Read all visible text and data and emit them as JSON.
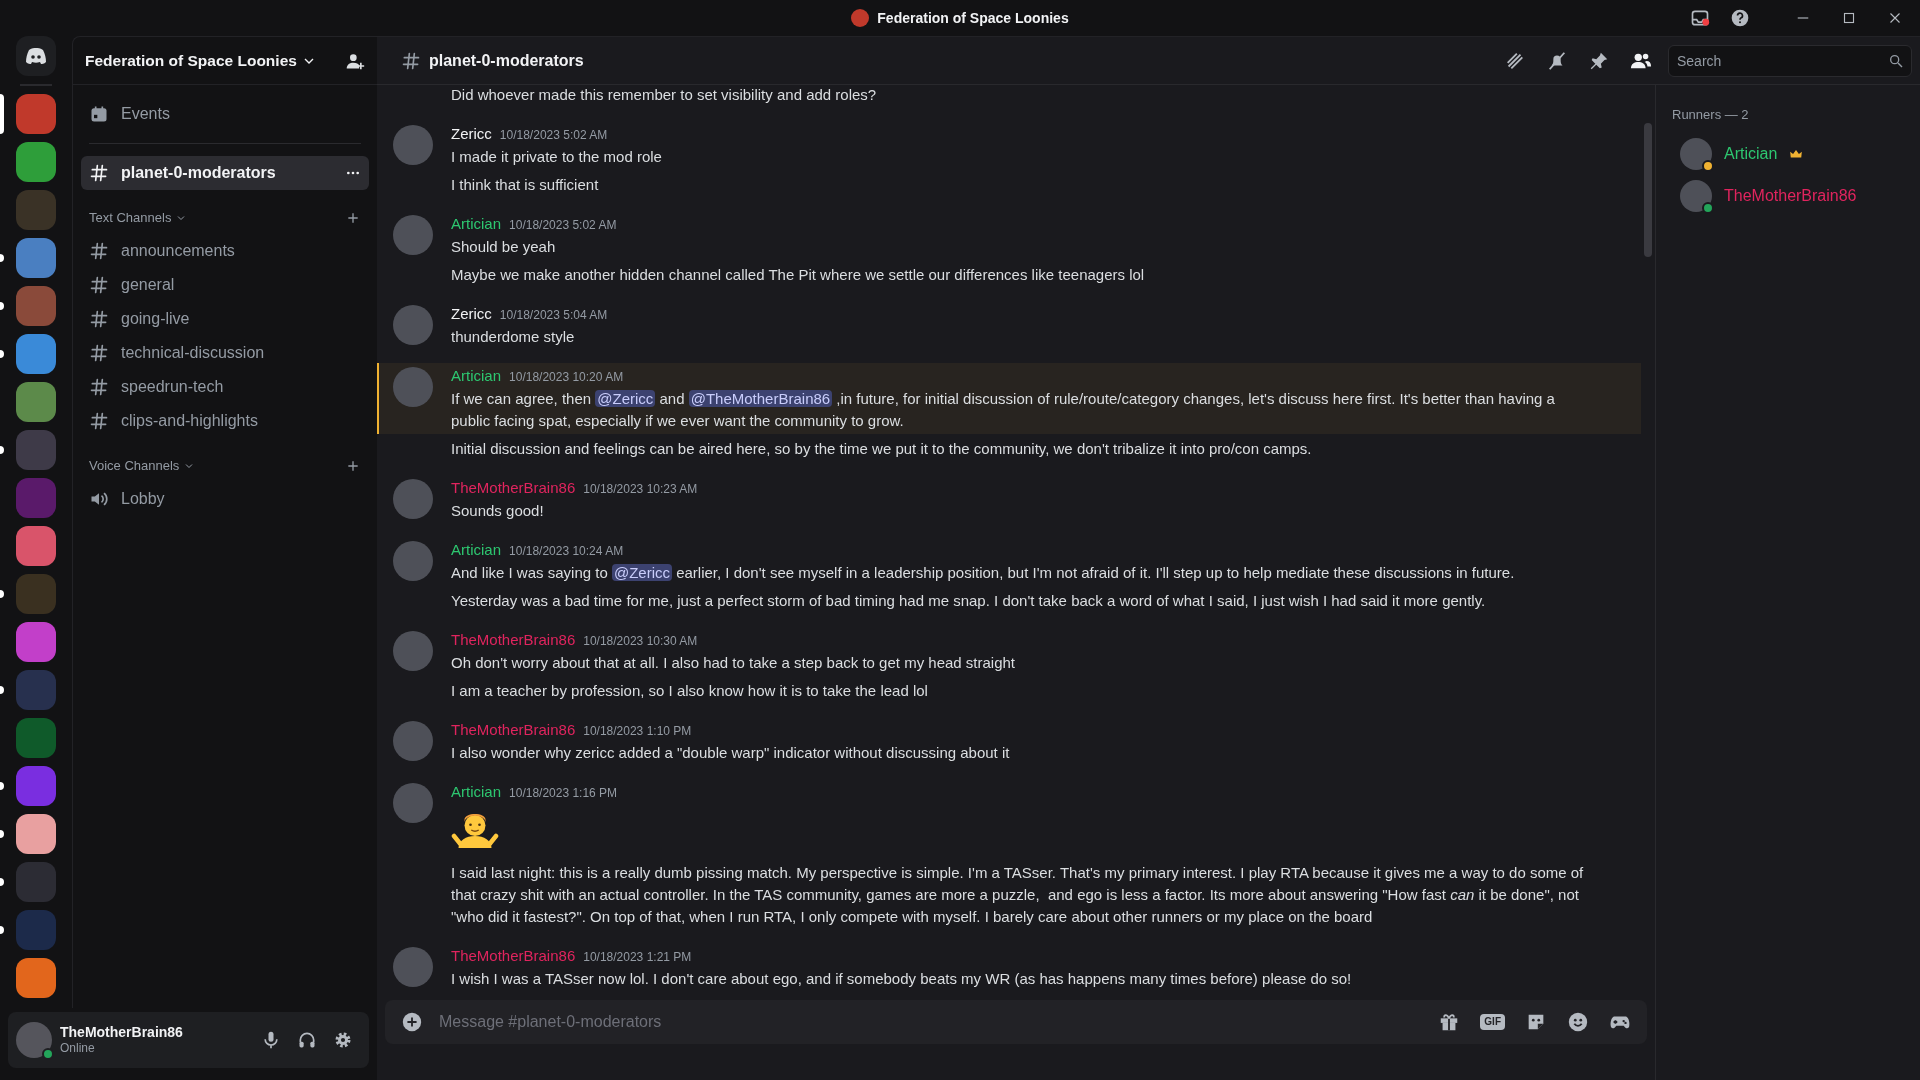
{
  "title_bar": {
    "title": "Federation of Space Loonies"
  },
  "servers": [
    {
      "color": "#c0392b",
      "selected": true
    },
    {
      "color": "#2e9e3a",
      "selected": false,
      "unread": false
    },
    {
      "color": "#3a3226",
      "selected": false,
      "unread": false
    },
    {
      "color": "#4a7fc1",
      "selected": false,
      "unread": true
    },
    {
      "color": "#8a4a3a",
      "selected": false,
      "unread": true
    },
    {
      "color": "#3a8ad8",
      "selected": false,
      "unread": true
    },
    {
      "color": "#5c8a4a",
      "selected": false,
      "unread": false
    },
    {
      "color": "#3e3a48",
      "selected": false,
      "unread": true
    },
    {
      "color": "#5a1a6a",
      "selected": false,
      "unread": false
    },
    {
      "color": "#d9546a",
      "selected": false,
      "unread": false
    },
    {
      "color": "#3a3020",
      "selected": false,
      "unread": true
    },
    {
      "color": "#c23fc9",
      "selected": false,
      "unread": false
    },
    {
      "color": "#27304e",
      "selected": false,
      "unread": true
    },
    {
      "color": "#0f5a2a",
      "selected": false,
      "unread": false
    },
    {
      "color": "#7a2ee0",
      "selected": false,
      "unread": true
    },
    {
      "color": "#e8a0a0",
      "selected": false,
      "unread": true
    },
    {
      "color": "#2c2c34",
      "selected": false,
      "unread": true
    },
    {
      "color": "#1c2a4a",
      "selected": false,
      "unread": true
    },
    {
      "color": "#e2661c",
      "selected": false,
      "unread": false
    }
  ],
  "sidebar": {
    "server_name": "Federation of Space Loonies",
    "events_label": "Events",
    "pinned_channel": {
      "name": "planet-0-moderators",
      "selected": true
    },
    "categories": [
      {
        "name": "Text Channels",
        "channels": [
          {
            "name": "announcements",
            "kind": "text",
            "selected": false
          },
          {
            "name": "general",
            "kind": "text",
            "selected": false
          },
          {
            "name": "going-live",
            "kind": "text",
            "selected": false
          },
          {
            "name": "technical-discussion",
            "kind": "text",
            "selected": false
          },
          {
            "name": "speedrun-tech",
            "kind": "text",
            "selected": false
          },
          {
            "name": "clips-and-highlights",
            "kind": "text",
            "selected": false
          }
        ]
      },
      {
        "name": "Voice Channels",
        "channels": [
          {
            "name": "Lobby",
            "kind": "voice",
            "selected": false
          }
        ]
      }
    ]
  },
  "user_panel": {
    "name": "TheMotherBrain86",
    "status": "Online"
  },
  "channel_header": {
    "name": "planet-0-moderators",
    "member_list_open": true
  },
  "search": {
    "placeholder": "Search"
  },
  "messages": [
    {
      "kind": "continuation",
      "lines": [
        {
          "kind": "text",
          "highlighted": false,
          "segments": [
            {
              "text": "Did whoever made this remember to set visibility and add roles?"
            }
          ]
        }
      ]
    },
    {
      "kind": "group",
      "author": "Zericc",
      "color": "#f2f3f5",
      "timestamp": "10/18/2023 5:02 AM",
      "lines": [
        {
          "kind": "text",
          "highlighted": false,
          "segments": [
            {
              "text": "I made it private to the mod role"
            }
          ]
        },
        {
          "kind": "text",
          "highlighted": false,
          "segments": [
            {
              "text": "I think that is sufficient"
            }
          ]
        }
      ]
    },
    {
      "kind": "group",
      "author": "Artician",
      "color": "#2dc770",
      "timestamp": "10/18/2023 5:02 AM",
      "lines": [
        {
          "kind": "text",
          "highlighted": false,
          "segments": [
            {
              "text": "Should be yeah"
            }
          ]
        },
        {
          "kind": "text",
          "highlighted": false,
          "segments": [
            {
              "text": "Maybe we make another hidden channel called The Pit where we settle our differences like teenagers lol"
            }
          ]
        }
      ]
    },
    {
      "kind": "group",
      "author": "Zericc",
      "color": "#f2f3f5",
      "timestamp": "10/18/2023 5:04 AM",
      "lines": [
        {
          "kind": "text",
          "highlighted": false,
          "segments": [
            {
              "text": "thunderdome style"
            }
          ]
        }
      ]
    },
    {
      "kind": "group",
      "author": "Artician",
      "color": "#2dc770",
      "timestamp": "10/18/2023 10:20 AM",
      "lines": [
        {
          "kind": "text",
          "highlighted": true,
          "segments": [
            {
              "text": "If we can agree, then "
            },
            {
              "mention": "@Zericc"
            },
            {
              "text": " and "
            },
            {
              "mention": "@TheMotherBrain86"
            },
            {
              "text": " ,in future, for initial discussion of rule/route/category changes, let's discuss here first. It's better than having a public facing spat, especially if we ever want the community to grow."
            }
          ]
        },
        {
          "kind": "text",
          "highlighted": false,
          "segments": [
            {
              "text": "Initial discussion and feelings can be aired here, so by the time we put it to the community, we don't tribalize it into pro/con camps."
            }
          ]
        }
      ]
    },
    {
      "kind": "group",
      "author": "TheMotherBrain86",
      "color": "#e0245e",
      "timestamp": "10/18/2023 10:23 AM",
      "lines": [
        {
          "kind": "text",
          "highlighted": false,
          "segments": [
            {
              "text": "Sounds good!"
            }
          ]
        }
      ]
    },
    {
      "kind": "group",
      "author": "Artician",
      "color": "#2dc770",
      "timestamp": "10/18/2023 10:24 AM",
      "lines": [
        {
          "kind": "text",
          "highlighted": false,
          "segments": [
            {
              "text": "And like I was saying to "
            },
            {
              "mention": "@Zericc"
            },
            {
              "text": " earlier, I don't see myself in a leadership position, but I'm not afraid of it. I'll step up to help mediate these discussions in future."
            }
          ]
        },
        {
          "kind": "text",
          "highlighted": false,
          "segments": [
            {
              "text": "Yesterday was a bad time for me, just a perfect storm of bad timing had me snap. I don't take back a word of what I said, I just wish I had said it more gently."
            }
          ]
        }
      ]
    },
    {
      "kind": "group",
      "author": "TheMotherBrain86",
      "color": "#e0245e",
      "timestamp": "10/18/2023 10:30 AM",
      "lines": [
        {
          "kind": "text",
          "highlighted": false,
          "segments": [
            {
              "text": "Oh don't worry about that at all. I also had to take a step back to get my head straight"
            }
          ]
        },
        {
          "kind": "text",
          "highlighted": false,
          "segments": [
            {
              "text": "I am a teacher by profession, so I also know how it is to take the lead lol"
            }
          ]
        }
      ]
    },
    {
      "kind": "group",
      "author": "TheMotherBrain86",
      "color": "#e0245e",
      "timestamp": "10/18/2023 1:10 PM",
      "lines": [
        {
          "kind": "text",
          "highlighted": false,
          "segments": [
            {
              "text": "I also wonder why zericc added a \"double warp\" indicator without discussing about it"
            }
          ]
        }
      ]
    },
    {
      "kind": "group",
      "author": "Artician",
      "color": "#2dc770",
      "timestamp": "10/18/2023 1:16 PM",
      "lines": [
        {
          "kind": "emoji",
          "highlighted": false
        },
        {
          "kind": "text",
          "highlighted": false,
          "segments": [
            {
              "text": "I said last night: this is a really dumb pissing match. My perspective is simple. I'm a TASser. That's my primary interest. I play RTA because it gives me a way to do some of that crazy shit with an actual controller. In the TAS community, games are more a puzzle,  and ego is less a factor. Its more about answering \"How fast *can* it be done\", not \"who did it fastest?\". On top of that, when I run RTA, I only compete with myself. I barely care about other runners or my place on the board"
            }
          ]
        }
      ]
    },
    {
      "kind": "group",
      "author": "TheMotherBrain86",
      "color": "#e0245e",
      "timestamp": "10/18/2023 1:21 PM",
      "lines": [
        {
          "kind": "text",
          "highlighted": false,
          "segments": [
            {
              "text": "I wish I was a TASser now lol. I don't care about ego, and if somebody beats my WR (as has happens many times before) please do so!"
            }
          ]
        }
      ]
    }
  ],
  "composer": {
    "placeholder": "Message #planet-0-moderators",
    "gif_label": "GIF"
  },
  "member_list": {
    "heading": "Runners — 2",
    "members": [
      {
        "name": "Artician",
        "color": "#2dc770",
        "status_dot": {
          "color": "#f0b232"
        },
        "owner": true
      },
      {
        "name": "TheMotherBrain86",
        "color": "#e0245e",
        "status_dot": {
          "color": "#23a55a"
        },
        "owner": false
      }
    ]
  }
}
